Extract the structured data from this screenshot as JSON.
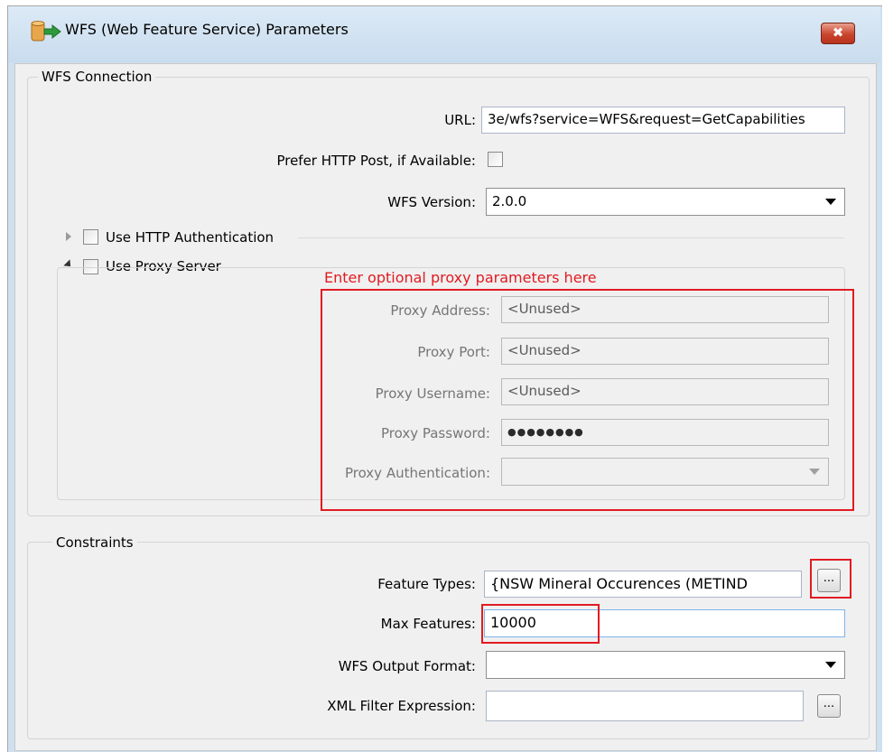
{
  "window": {
    "title": "WFS (Web Feature Service) Parameters",
    "close_glyph": "✖",
    "icon": "database-arrow-icon"
  },
  "wfs_connection": {
    "title": "WFS Connection",
    "url_label": "URL:",
    "url_value": "3e/wfs?service=WFS&request=GetCapabilities",
    "prefer_post_label": "Prefer HTTP Post, if Available:",
    "prefer_post_checked": false,
    "version_label": "WFS Version:",
    "version_value": "2.0.0",
    "http_auth_label": "Use HTTP Authentication",
    "http_auth_checked": false,
    "proxy_label": "Use Proxy Server",
    "proxy_checked": false
  },
  "annotation": {
    "text": "Enter optional proxy parameters here",
    "color": "#e11b22"
  },
  "proxy": {
    "address_label": "Proxy Address:",
    "address_value": "<Unused>",
    "port_label": "Proxy Port:",
    "port_value": "<Unused>",
    "username_label": "Proxy Username:",
    "username_value": "<Unused>",
    "password_label": "Proxy Password:",
    "password_value": "●●●●●●●●",
    "auth_label": "Proxy Authentication:",
    "auth_value": ""
  },
  "constraints": {
    "title": "Constraints",
    "feature_types_label": "Feature Types:",
    "feature_types_value": "{NSW Mineral Occurences (METIND",
    "max_features_label": "Max Features:",
    "max_features_value": "10000",
    "output_format_label": "WFS Output Format:",
    "output_format_value": "",
    "xml_filter_label": "XML Filter Expression:",
    "xml_filter_value": "",
    "ellipsis": "..."
  }
}
